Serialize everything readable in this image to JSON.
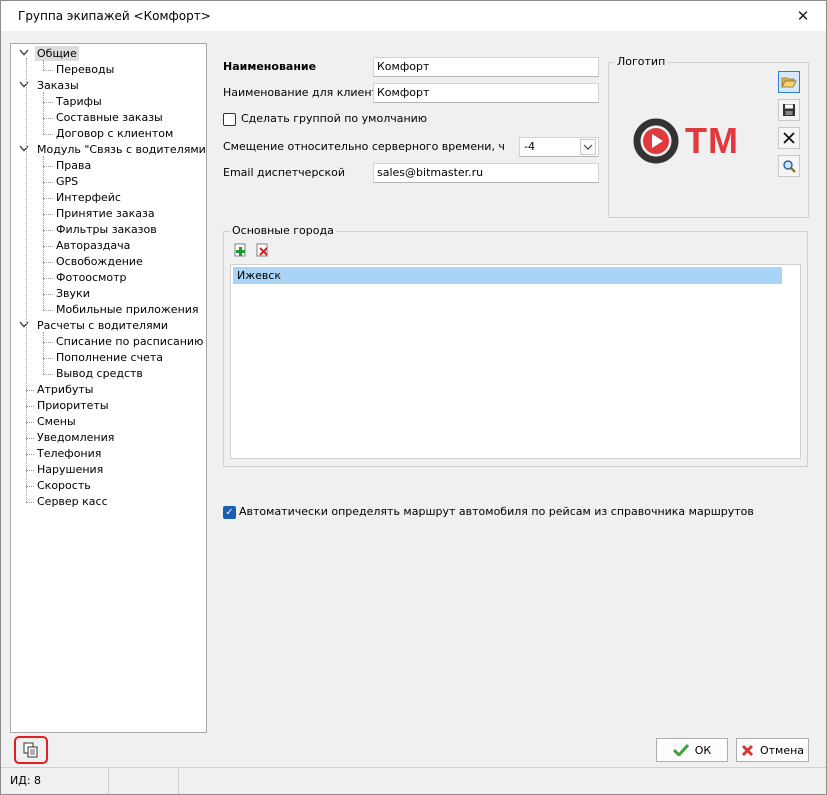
{
  "window": {
    "title": "Группа экипажей <Комфорт>",
    "close_glyph": "✕"
  },
  "tree": {
    "items": [
      {
        "label": "Общие",
        "level": 0,
        "expandable": true,
        "selected": true
      },
      {
        "label": "Переводы",
        "level": 1
      },
      {
        "label": "Заказы",
        "level": 0,
        "expandable": true
      },
      {
        "label": "Тарифы",
        "level": 1
      },
      {
        "label": "Составные заказы",
        "level": 1
      },
      {
        "label": "Договор с клиентом",
        "level": 1
      },
      {
        "label": "Модуль \"Связь с водителями\"",
        "level": 0,
        "expandable": true
      },
      {
        "label": "Права",
        "level": 1
      },
      {
        "label": "GPS",
        "level": 1
      },
      {
        "label": "Интерфейс",
        "level": 1
      },
      {
        "label": "Принятие заказа",
        "level": 1
      },
      {
        "label": "Фильтры заказов",
        "level": 1
      },
      {
        "label": "Автораздача",
        "level": 1
      },
      {
        "label": "Освобождение",
        "level": 1
      },
      {
        "label": "Фотоосмотр",
        "level": 1
      },
      {
        "label": "Звуки",
        "level": 1
      },
      {
        "label": "Мобильные приложения",
        "level": 1
      },
      {
        "label": "Расчеты с водителями",
        "level": 0,
        "expandable": true
      },
      {
        "label": "Списание по расписанию",
        "level": 1
      },
      {
        "label": "Пополнение счета",
        "level": 1
      },
      {
        "label": "Вывод средств",
        "level": 1
      },
      {
        "label": "Атрибуты",
        "level": 0
      },
      {
        "label": "Приоритеты",
        "level": 0
      },
      {
        "label": "Смены",
        "level": 0
      },
      {
        "label": "Уведомления",
        "level": 0
      },
      {
        "label": "Телефония",
        "level": 0
      },
      {
        "label": "Нарушения",
        "level": 0
      },
      {
        "label": "Скорость",
        "level": 0
      },
      {
        "label": "Сервер касс",
        "level": 0
      }
    ]
  },
  "form": {
    "name_label": "Наименование",
    "name_value": "Комфорт",
    "client_name_label": "Наименование для клиента",
    "client_name_value": "Комфорт",
    "default_group_label": "Сделать группой по умолчанию",
    "default_group_checked": false,
    "offset_label": "Смещение относительно серверного времени, ч",
    "offset_value": "-4",
    "email_label": "Email диспетчерской",
    "email_value": "sales@bitmaster.ru"
  },
  "logo": {
    "caption": "Логотип",
    "text": "TM",
    "brand_color": "#e03a3e",
    "dark_color": "#333333",
    "tools": [
      "open-folder-icon",
      "save-icon",
      "delete-icon",
      "zoom-icon"
    ]
  },
  "cities": {
    "caption": "Основные города",
    "add_icon": "add-icon",
    "remove_icon": "remove-icon",
    "rows": [
      "Ижевск"
    ]
  },
  "auto_route": {
    "label": "Автоматически определять маршрут автомобиля по рейсам из справочника маршрутов",
    "checked": true
  },
  "buttons": {
    "ok": "ОК",
    "cancel": "Отмена"
  },
  "status": {
    "id_text": "ИД: 8"
  }
}
